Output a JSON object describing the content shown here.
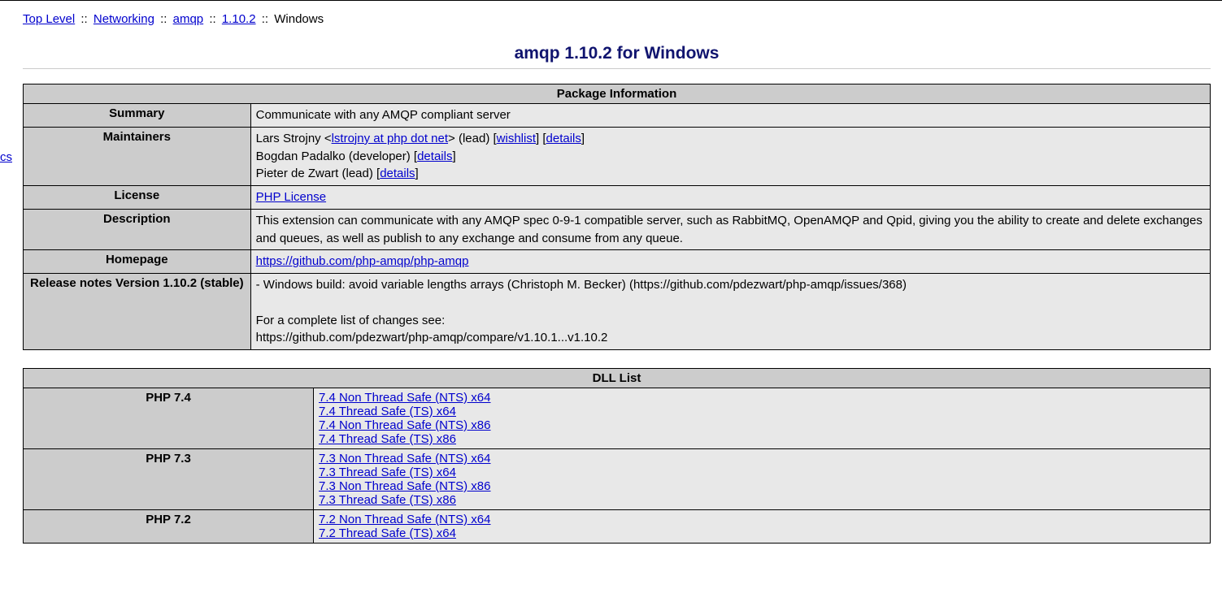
{
  "sidebar_edge": "cs",
  "breadcrumb": {
    "top": "Top Level",
    "networking": "Networking",
    "amqp": "amqp",
    "version": "1.10.2",
    "windows": "Windows",
    "sep": "::"
  },
  "page_title": "amqp 1.10.2 for Windows",
  "package_info": {
    "header": "Package Information",
    "rows": {
      "summary_label": "Summary",
      "summary": "Communicate with any AMQP compliant server",
      "maintainers_label": "Maintainers",
      "m1a": "Lars Strojny <",
      "m1b": "lstrojny at php dot net",
      "m1c": "> (lead) [",
      "m1d": "wishlist",
      "m1e": "] [",
      "m1f": "details",
      "m1g": "]",
      "m2a": "Bogdan Padalko (developer) [",
      "m2b": "details",
      "m2c": "]",
      "m3a": "Pieter de Zwart (lead) [",
      "m3b": "details",
      "m3c": "]",
      "license_label": "License",
      "license": "PHP License",
      "description_label": "Description",
      "description": "This extension can communicate with any AMQP spec 0-9-1 compatible server, such as RabbitMQ, OpenAMQP and Qpid, giving you the ability to create and delete exchanges and queues, as well as publish to any exchange and consume from any queue.",
      "homepage_label": "Homepage",
      "homepage": "https://github.com/php-amqp/php-amqp",
      "release_label": "Release notes\nVersion 1.10.2\n(stable)",
      "release_notes": "- Windows build: avoid variable lengths arrays (Christoph M. Becker) (https://github.com/pdezwart/php-amqp/issues/368)\n\nFor a complete list of changes see:\nhttps://github.com/pdezwart/php-amqp/compare/v1.10.1...v1.10.2"
    }
  },
  "dll_list": {
    "header": "DLL List",
    "rows": [
      {
        "php": "PHP 7.4",
        "links": [
          "7.4 Non Thread Safe (NTS) x64",
          "7.4 Thread Safe (TS) x64",
          "7.4 Non Thread Safe (NTS) x86",
          "7.4 Thread Safe (TS) x86"
        ]
      },
      {
        "php": "PHP 7.3",
        "links": [
          "7.3 Non Thread Safe (NTS) x64",
          "7.3 Thread Safe (TS) x64",
          "7.3 Non Thread Safe (NTS) x86",
          "7.3 Thread Safe (TS) x86"
        ]
      },
      {
        "php": "PHP 7.2",
        "links": [
          "7.2 Non Thread Safe (NTS) x64",
          "7.2 Thread Safe (TS) x64"
        ]
      }
    ]
  }
}
